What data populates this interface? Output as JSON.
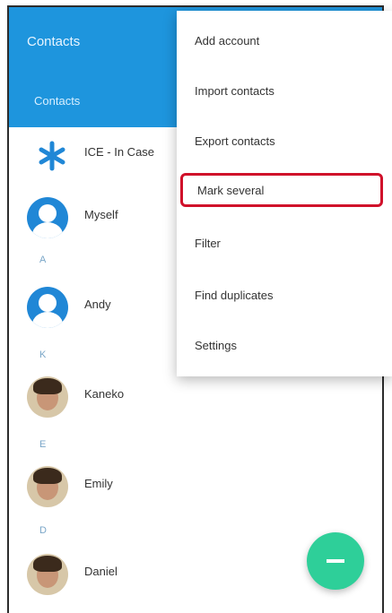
{
  "header": {
    "title": "Contacts",
    "tab": "Contacts"
  },
  "menu": {
    "items": [
      "Add account",
      "Import contacts",
      "Export contacts",
      "Mark several",
      "Filter",
      "Find duplicates",
      "Settings"
    ],
    "highlighted_index": 3,
    "highlight_color": "#d0102a"
  },
  "contacts": [
    {
      "name": "ICE - In Case",
      "icon": "asterisk-icon"
    },
    {
      "name": "Myself",
      "icon": "person-icon"
    },
    {
      "name": "Andy",
      "icon": "person-icon"
    },
    {
      "name": "Kaneko",
      "icon": "photo-avatar"
    },
    {
      "name": "Emily",
      "icon": "photo-avatar"
    },
    {
      "name": "Daniel",
      "icon": "photo-avatar"
    }
  ],
  "section_letters": [
    "A",
    "K",
    "E",
    "D"
  ],
  "colors": {
    "header": "#1e95dd",
    "fab": "#2ecf99",
    "avatar_blue": "#2087d6"
  }
}
